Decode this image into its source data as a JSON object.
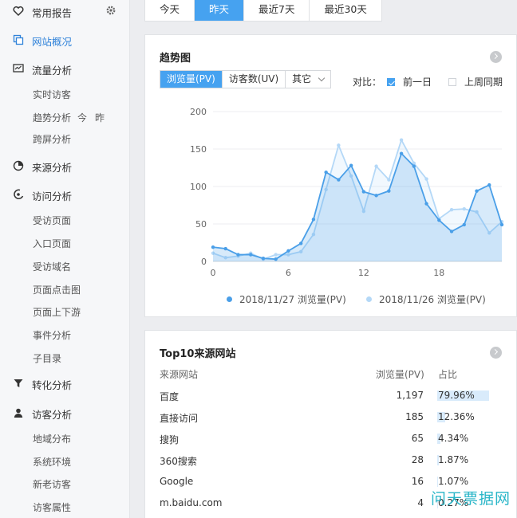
{
  "sidebar": {
    "common_reports": "常用报告",
    "overview": "网站概况",
    "traffic": {
      "label": "流量分析",
      "items": [
        "实时访客",
        "趋势分析",
        "跨屏分析"
      ],
      "trend_extras": [
        "今",
        "昨"
      ]
    },
    "source": "来源分析",
    "visit": {
      "label": "访问分析",
      "items": [
        "受访页面",
        "入口页面",
        "受访域名",
        "页面点击图",
        "页面上下游",
        "事件分析",
        "子目录"
      ]
    },
    "conversion": "转化分析",
    "visitor": {
      "label": "访客分析",
      "items": [
        "地域分布",
        "系统环境",
        "新老访客",
        "访客属性"
      ]
    }
  },
  "date_tabs": [
    {
      "label": "今天",
      "active": false
    },
    {
      "label": "昨天",
      "active": true
    },
    {
      "label": "最近7天",
      "active": false
    },
    {
      "label": "最近30天",
      "active": false
    }
  ],
  "trend": {
    "title": "趋势图",
    "metric_tabs": [
      "浏览量(PV)",
      "访客数(UV)",
      "其它"
    ],
    "compare_label": "对比：",
    "compare_options": [
      {
        "label": "前一日",
        "checked": true
      },
      {
        "label": "上周同期",
        "checked": false
      }
    ]
  },
  "chart_data": {
    "type": "area",
    "x": [
      0,
      1,
      2,
      3,
      4,
      5,
      6,
      7,
      8,
      9,
      10,
      11,
      12,
      13,
      14,
      15,
      16,
      17,
      18,
      19,
      20,
      21,
      22,
      23
    ],
    "xticks": [
      0,
      6,
      12,
      18
    ],
    "yticks": [
      0,
      50,
      100,
      150,
      200
    ],
    "ylim": [
      0,
      200
    ],
    "grid": true,
    "legend_position": "bottom",
    "series": [
      {
        "name": "2018/11/27 浏览量(PV)",
        "color": "#4a9fe8",
        "values": [
          19,
          17,
          9,
          9,
          4,
          3,
          14,
          24,
          56,
          119,
          109,
          128,
          93,
          88,
          94,
          144,
          127,
          77,
          55,
          40,
          49,
          94,
          102,
          49
        ]
      },
      {
        "name": "2018/11/26 浏览量(PV)",
        "color": "#b4d8f7",
        "values": [
          11,
          5,
          7,
          11,
          3,
          9,
          9,
          13,
          36,
          96,
          155,
          114,
          67,
          127,
          109,
          162,
          131,
          110,
          57,
          69,
          70,
          66,
          38,
          53
        ]
      }
    ]
  },
  "top10": {
    "title": "Top10来源网站",
    "headers": [
      "来源网站",
      "浏览量(PV)",
      "占比"
    ],
    "rows": [
      {
        "site": "百度",
        "pv": "1,197",
        "pct": "79.96%",
        "ratio": 0.7996
      },
      {
        "site": "直接访问",
        "pv": "185",
        "pct": "12.36%",
        "ratio": 0.1236
      },
      {
        "site": "搜狗",
        "pv": "65",
        "pct": "4.34%",
        "ratio": 0.0434
      },
      {
        "site": "360搜索",
        "pv": "28",
        "pct": "1.87%",
        "ratio": 0.0187
      },
      {
        "site": "Google",
        "pv": "16",
        "pct": "1.07%",
        "ratio": 0.0107
      },
      {
        "site": "m.baidu.com",
        "pv": "4",
        "pct": "0.27%",
        "ratio": 0.0027
      }
    ]
  },
  "watermark": "问天票据网",
  "colors": {
    "accent": "#46a2f0",
    "series1": "#4a9fe8",
    "series2": "#b4d8f7"
  }
}
